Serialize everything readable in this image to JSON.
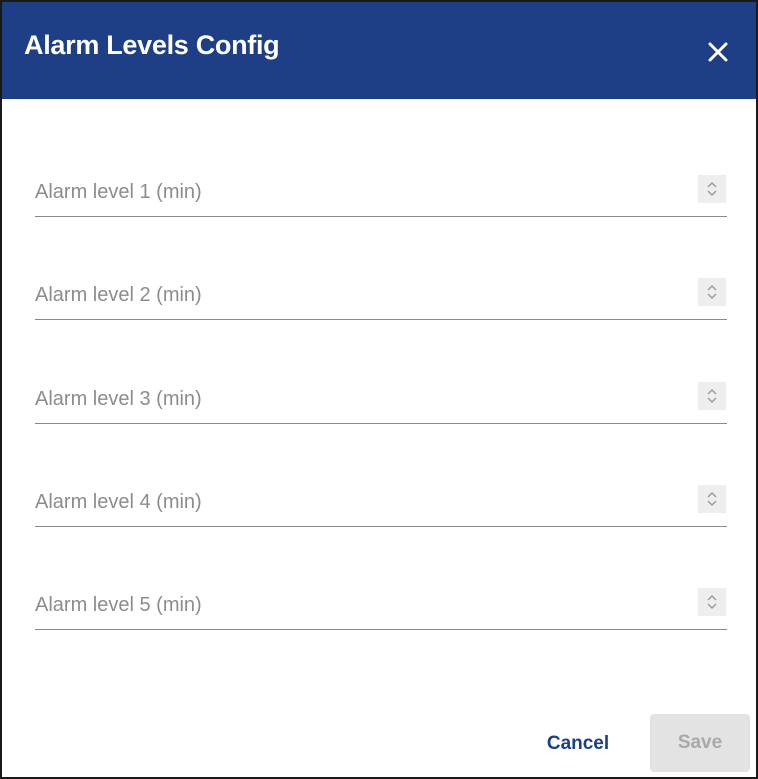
{
  "dialog": {
    "title": "Alarm Levels Config",
    "close_icon": "close-icon",
    "colors": {
      "header_bg": "#1e3f86",
      "title_text": "#ffffff",
      "primary": "#1e3f86",
      "disabled_bg": "#e3e3e3",
      "disabled_text": "#a9a9a9"
    }
  },
  "fields": [
    {
      "placeholder": "Alarm level 1 (min)",
      "value": "",
      "icon": "stepper-icon"
    },
    {
      "placeholder": "Alarm level 2 (min)",
      "value": "",
      "icon": "stepper-icon"
    },
    {
      "placeholder": "Alarm level 3 (min)",
      "value": "",
      "icon": "stepper-icon"
    },
    {
      "placeholder": "Alarm level 4 (min)",
      "value": "",
      "icon": "stepper-icon"
    },
    {
      "placeholder": "Alarm level 5 (min)",
      "value": "",
      "icon": "stepper-icon"
    }
  ],
  "actions": {
    "cancel_label": "Cancel",
    "save_label": "Save",
    "save_disabled": true
  }
}
